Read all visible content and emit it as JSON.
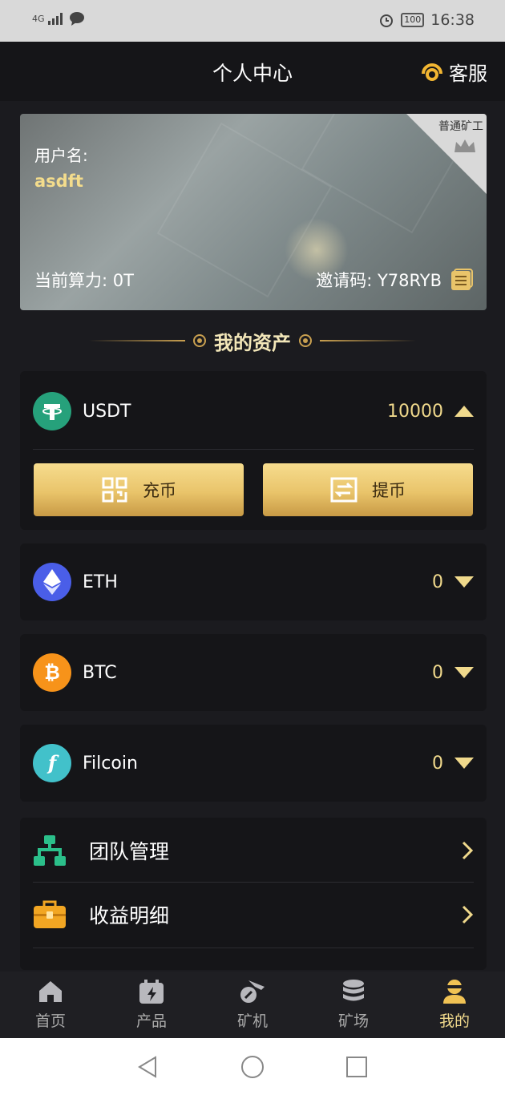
{
  "status_bar": {
    "network": "4G",
    "battery": "100",
    "time": "16:38"
  },
  "header": {
    "title": "个人中心",
    "service_label": "客服"
  },
  "user_card": {
    "username_label": "用户名:",
    "username": "asdft",
    "power": "当前算力: 0T",
    "invite": "邀请码: Y78RYB",
    "level": "普通矿工"
  },
  "assets": {
    "section_title": "我的资产",
    "items": [
      {
        "name": "USDT",
        "value": "10000",
        "icon": "tether-icon",
        "color": "#26a17b",
        "expanded": true
      },
      {
        "name": "ETH",
        "value": "0",
        "icon": "ethereum-icon",
        "color": "#4a5ee8",
        "expanded": false
      },
      {
        "name": "BTC",
        "value": "0",
        "icon": "bitcoin-icon",
        "color": "#f7931a",
        "expanded": false
      },
      {
        "name": "Filcoin",
        "value": "0",
        "icon": "filecoin-icon",
        "color": "#42c1ca",
        "expanded": false
      }
    ],
    "deposit_label": "充币",
    "withdraw_label": "提币"
  },
  "menu": {
    "items": [
      {
        "label": "团队管理",
        "icon": "team-icon"
      },
      {
        "label": "收益明细",
        "icon": "briefcase-icon"
      }
    ]
  },
  "nav": {
    "items": [
      {
        "label": "首页",
        "icon": "home-icon"
      },
      {
        "label": "产品",
        "icon": "product-icon"
      },
      {
        "label": "矿机",
        "icon": "miner-icon"
      },
      {
        "label": "矿场",
        "icon": "mine-field-icon"
      },
      {
        "label": "我的",
        "icon": "user-icon",
        "active": true
      }
    ]
  },
  "theme": {
    "gold": "#f0d98c",
    "background": "#1b1b1f",
    "panel": "#151518"
  }
}
